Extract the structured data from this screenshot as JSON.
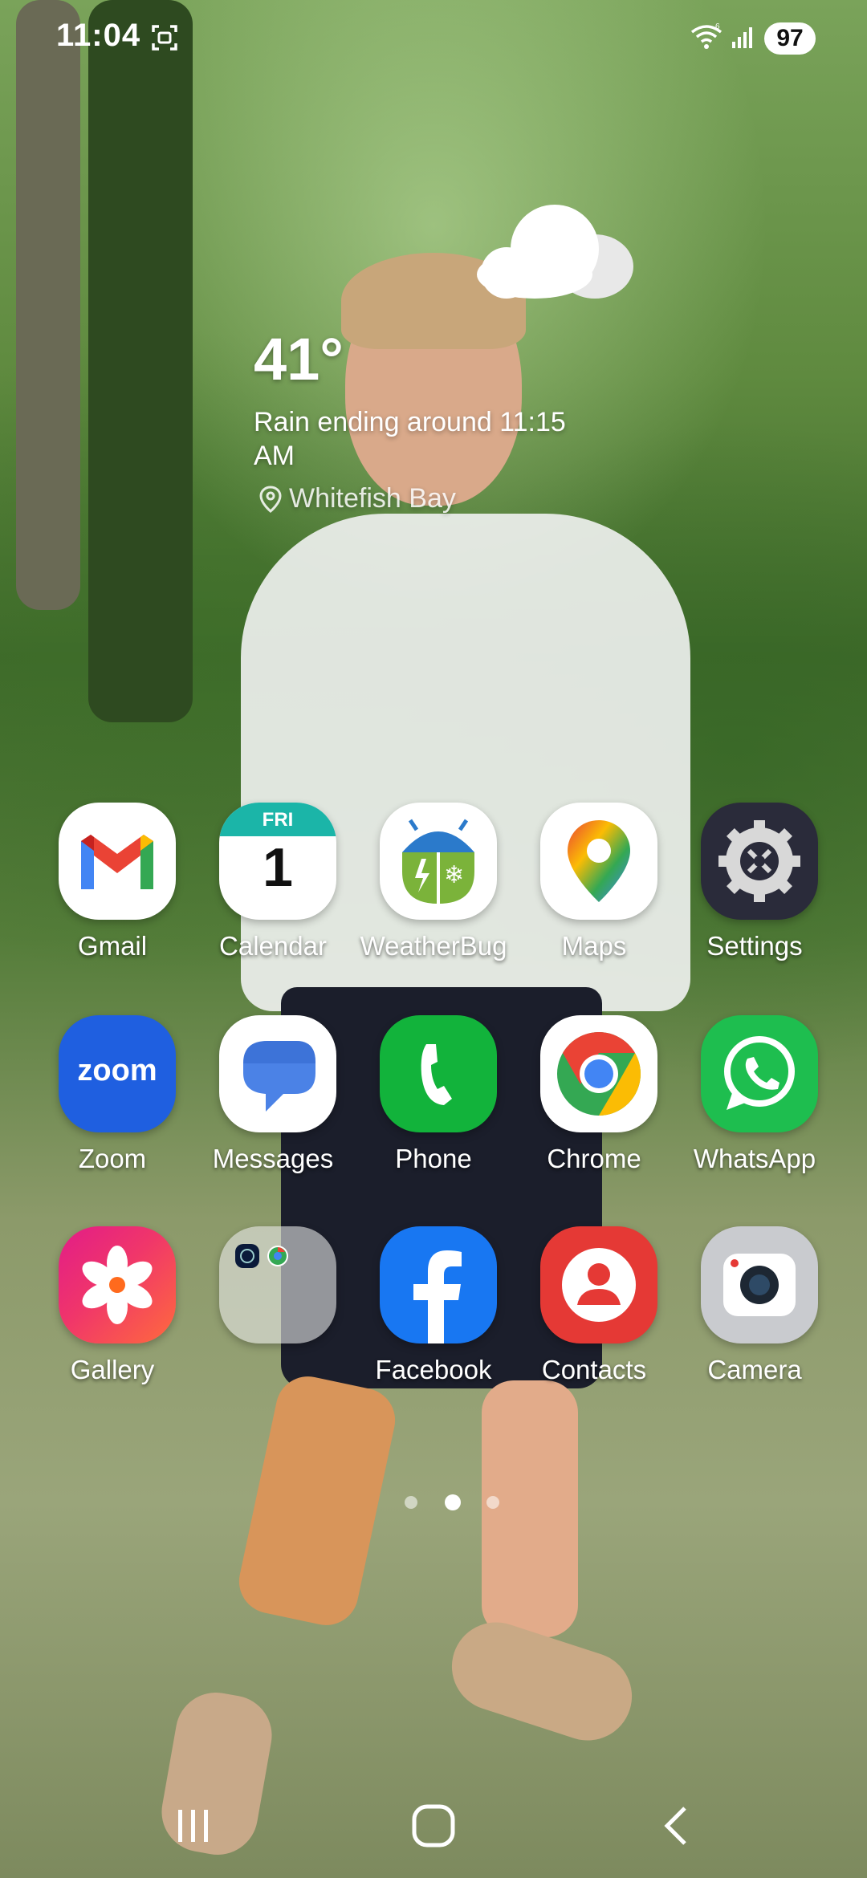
{
  "status_bar": {
    "time": "11:04",
    "battery": "97",
    "icons": [
      "screenshot-icon",
      "wifi-icon",
      "signal-icon"
    ]
  },
  "weather": {
    "temperature": "41°",
    "condition": "Rain ending around 11:15 AM",
    "location": "Whitefish Bay",
    "icon": "cloud-icon"
  },
  "apps": [
    {
      "label": "Gmail",
      "icon": "gmail-icon"
    },
    {
      "label": "Calendar",
      "icon": "calendar-icon",
      "day_name": "FRI",
      "day_number": "1"
    },
    {
      "label": "WeatherBug",
      "icon": "weatherbug-icon"
    },
    {
      "label": "Maps",
      "icon": "maps-icon"
    },
    {
      "label": "Settings",
      "icon": "settings-icon"
    },
    {
      "label": "Zoom",
      "icon": "zoom-icon",
      "logo_text": "zoom"
    },
    {
      "label": "Messages",
      "icon": "messages-icon"
    },
    {
      "label": "Phone",
      "icon": "phone-icon"
    },
    {
      "label": "Chrome",
      "icon": "chrome-icon"
    },
    {
      "label": "WhatsApp",
      "icon": "whatsapp-icon"
    },
    {
      "label": "Gallery",
      "icon": "gallery-icon"
    },
    {
      "label": "",
      "icon": "folder-icon"
    },
    {
      "label": "Facebook",
      "icon": "facebook-icon"
    },
    {
      "label": "Contacts",
      "icon": "contacts-icon"
    },
    {
      "label": "Camera",
      "icon": "camera-icon"
    }
  ],
  "page_indicator": {
    "pages": 3,
    "current": 2
  },
  "nav_bar": {
    "buttons": [
      "recents-button",
      "home-button",
      "back-button"
    ]
  },
  "colors": {
    "gmail_red": "#EA4335",
    "calendar_teal": "#1BB5A8",
    "weatherbug_green": "#7BB33A",
    "zoom_blue": "#1F5FE0",
    "phone_green": "#12B33B",
    "whatsapp_green": "#1EBE4F",
    "facebook_blue": "#1877F2",
    "contacts_red": "#E53935"
  }
}
